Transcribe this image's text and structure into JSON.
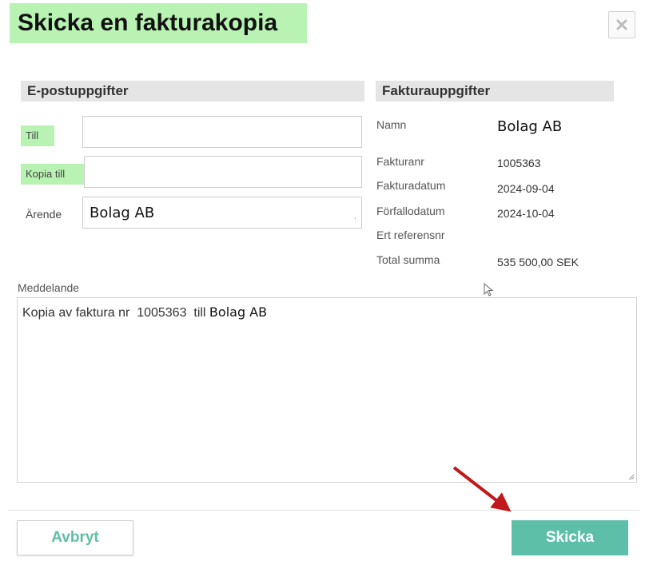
{
  "dialog": {
    "title": "Skicka en fakturakopia"
  },
  "email_section": {
    "heading": "E-postuppgifter",
    "to_label": "Till",
    "to_value": "",
    "cc_label": "Kopia till",
    "cc_value": "",
    "subject_label": "Ärende",
    "subject_value": "Bolag AB"
  },
  "invoice_section": {
    "heading": "Fakturauppgifter",
    "fields": [
      {
        "label": "Namn",
        "value": "Bolag AB"
      },
      {
        "label": "Fakturanr",
        "value": "1005363"
      },
      {
        "label": "Fakturadatum",
        "value": "2024-09-04"
      },
      {
        "label": "Förfallodatum",
        "value": "2024-10-04"
      },
      {
        "label": "Ert referensnr",
        "value": ""
      },
      {
        "label": "Total summa",
        "value": "535 500,00 SEK"
      }
    ]
  },
  "message": {
    "label": "Meddelande",
    "text_prefix": "Kopia av faktura nr  1005363  till ",
    "text_name": "Bolag AB"
  },
  "buttons": {
    "cancel": "Avbryt",
    "send": "Skicka"
  },
  "colors": {
    "highlight": "#b9f3b3",
    "accent": "#5dbfa8",
    "arrow": "#c0191b"
  },
  "icons": {
    "close": "close-icon",
    "cursor": "mouse-pointer-icon",
    "annotation": "red-arrow-icon"
  }
}
